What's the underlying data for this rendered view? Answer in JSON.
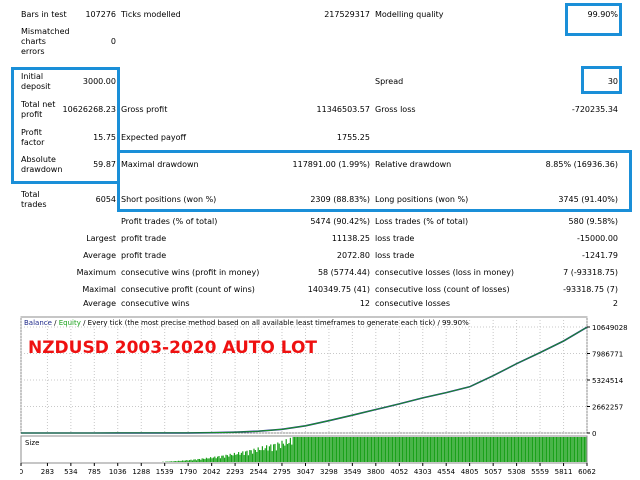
{
  "stats": {
    "bars_in_test": {
      "label": "Bars in test",
      "value": "107276"
    },
    "ticks_modelled": {
      "label": "Ticks modelled",
      "value": "217529317"
    },
    "modelling_quality": {
      "label": "Modelling quality",
      "value": "99.90%"
    },
    "mismatched": {
      "label_lines": [
        "Mismatched",
        "charts",
        "errors"
      ],
      "value": "0"
    },
    "initial_deposit": {
      "label_lines": [
        "Initial",
        "deposit"
      ],
      "value": "3000.00"
    },
    "spread": {
      "label": "Spread",
      "value": "30"
    },
    "total_net_profit": {
      "label_lines": [
        "Total net",
        "profit"
      ],
      "value": "10626268.23"
    },
    "gross_profit": {
      "label": "Gross profit",
      "value": "11346503.57"
    },
    "gross_loss": {
      "label": "Gross loss",
      "value": "-720235.34"
    },
    "profit_factor": {
      "label_lines": [
        "Profit",
        "factor"
      ],
      "value": "15.75"
    },
    "expected_payoff": {
      "label": "Expected payoff",
      "value": "1755.25"
    },
    "absolute_drawdown": {
      "label_lines": [
        "Absolute",
        "drawdown"
      ],
      "value": "59.87"
    },
    "maximal_drawdown": {
      "label": "Maximal drawdown",
      "value": "117891.00 (1.99%)"
    },
    "relative_drawdown": {
      "label": "Relative drawdown",
      "value": "8.85% (16936.36)"
    },
    "total_trades": {
      "label_lines": [
        "Total",
        "trades"
      ],
      "value": "6054"
    },
    "short_positions": {
      "label": "Short positions (won %)",
      "value": "2309 (88.83%)"
    },
    "long_positions": {
      "label": "Long positions (won %)",
      "value": "3745 (91.40%)"
    },
    "profit_trades": {
      "label": "Profit trades (% of total)",
      "value": "5474 (90.42%)"
    },
    "loss_trades": {
      "label": "Loss trades (% of total)",
      "value": "580 (9.58%)"
    },
    "largest": {
      "prefix": "Largest",
      "profit_label": "profit trade",
      "profit_value": "11138.25",
      "loss_label": "loss trade",
      "loss_value": "-15000.00"
    },
    "average": {
      "prefix": "Average",
      "profit_label": "profit trade",
      "profit_value": "2072.80",
      "loss_label": "loss trade",
      "loss_value": "-1241.79"
    },
    "maximum": {
      "prefix": "Maximum",
      "wins_label": "consecutive wins (profit in money)",
      "wins_value": "58 (5774.44)",
      "losses_label": "consecutive losses (loss in money)",
      "losses_value": "7 (-93318.75)"
    },
    "maximal": {
      "prefix": "Maximal",
      "wins_label": "consecutive profit (count of wins)",
      "wins_value": "140349.75 (41)",
      "losses_label": "consecutive loss (count of losses)",
      "losses_value": "-93318.75 (7)"
    },
    "average_consecutive": {
      "prefix": "Average",
      "wins_label": "consecutive wins",
      "wins_value": "12",
      "losses_label": "consecutive losses",
      "losses_value": "2"
    }
  },
  "chart_data": {
    "type": "line",
    "legend": {
      "balance": "Balance",
      "sep1": " / ",
      "equity": "Equity",
      "rest": " / Every tick (the most precise method based on all available least timeframes to generate each tick) / 99.90%"
    },
    "title": "NZDUSD 2003-2020 AUTO LOT",
    "y_ticks": [
      "10649028",
      "7986771",
      "5324514",
      "2662257",
      "0"
    ],
    "x_ticks": [
      "0",
      "283",
      "534",
      "785",
      "1036",
      "1288",
      "1539",
      "1790",
      "2042",
      "2293",
      "2544",
      "2795",
      "3047",
      "3298",
      "3549",
      "3800",
      "4052",
      "4303",
      "4554",
      "4805",
      "5057",
      "5308",
      "5559",
      "5811",
      "6062"
    ],
    "ylim": [
      0,
      10649028
    ],
    "x": [
      0,
      283,
      534,
      785,
      1036,
      1288,
      1539,
      1790,
      2042,
      2293,
      2544,
      2795,
      3047,
      3298,
      3549,
      3800,
      4052,
      4303,
      4554,
      4805,
      5057,
      5308,
      5559,
      5811,
      6062
    ],
    "series": [
      {
        "name": "Balance",
        "values": [
          3000,
          3500,
          4200,
          5000,
          6000,
          7500,
          10000,
          14000,
          30000,
          80000,
          180000,
          370000,
          720000,
          1240000,
          1790000,
          2360000,
          2920000,
          3530000,
          4060000,
          4640000,
          5760000,
          6960000,
          8080000,
          9240000,
          10629268
        ]
      },
      {
        "name": "Equity",
        "values": [
          3000,
          3500,
          4200,
          5000,
          6000,
          7500,
          10000,
          14000,
          30000,
          80000,
          180000,
          370000,
          720000,
          1240000,
          1790000,
          2360000,
          2920000,
          3530000,
          4060000,
          4640000,
          5760000,
          6960000,
          8080000,
          9240000,
          10629268
        ]
      }
    ],
    "size_panel": {
      "label": "Size"
    },
    "colors": {
      "balance": "#1f2a8a",
      "equity": "#18a018",
      "size": "#1aa11a",
      "title": "#ee1111",
      "grid": "#c8c8c8"
    }
  }
}
